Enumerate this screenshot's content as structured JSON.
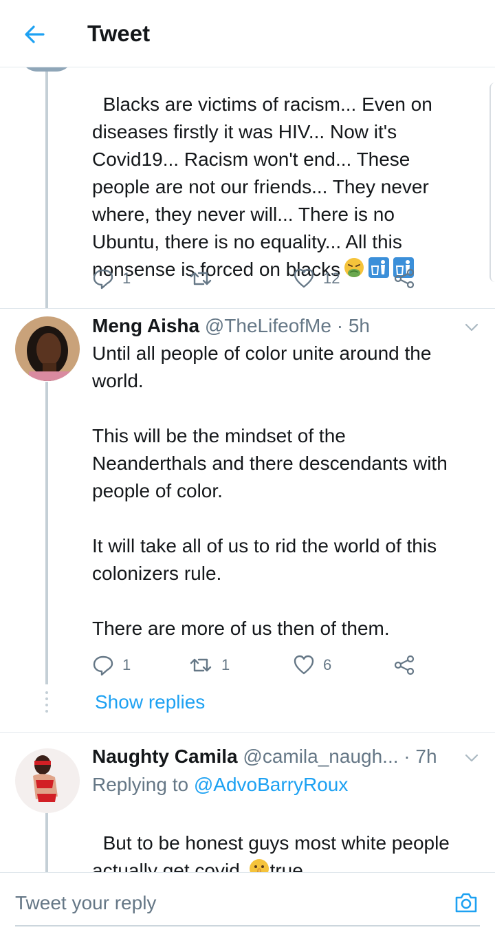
{
  "header": {
    "title": "Tweet"
  },
  "tweets": [
    {
      "text": "Blacks are victims of racism... Even on\ndiseases firstly it was HIV... Now it's\nCovid19... Racism won't end... These\npeople are not our friends... They never\nwhere, they never will... There is no\nUbuntu, there is no equality... All this\nnonsense is forced on blacks",
      "emojis": [
        "nauseated-face",
        "litter-bin",
        "litter-bin"
      ],
      "replies": "1",
      "retweets": "",
      "likes": "12"
    },
    {
      "name": "Meng Aisha",
      "handle": "@TheLifeofMe",
      "time": "· 5h",
      "text": "Until all people of color unite around the\nworld.\n\nThis will be the mindset of the\nNeanderthals and there descendants with\npeople of color.\n\nIt will take all of us to rid the world of this\ncolonizers rule.\n\nThere are more of us then of them.",
      "replies": "1",
      "retweets": "1",
      "likes": "6",
      "show_replies": "Show replies"
    },
    {
      "name": "Naughty Camila",
      "handle": "@camila_naugh...",
      "time": "· 7h",
      "replying_prefix": "Replying to ",
      "replying_to": "@AdvoBarryRoux",
      "text_before_emoji": "But to be honest guys most white people\nactually get covid ",
      "emoji": "shushing-face",
      "text_after_emoji": "true"
    }
  ],
  "composer": {
    "placeholder": "Tweet your reply"
  },
  "colors": {
    "accent": "#1da1f2",
    "secondary_text": "#657786",
    "divider": "#e1e8ed"
  }
}
